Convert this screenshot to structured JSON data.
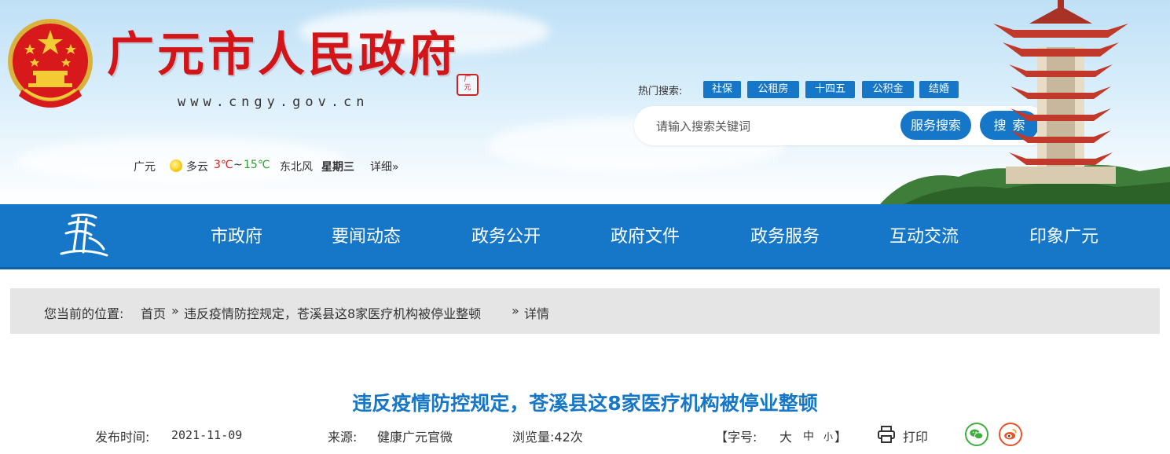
{
  "header": {
    "site_title": "广元市人民政府",
    "site_url": "www.cngy.gov.cn",
    "seal_text": "广元市"
  },
  "hot_search": {
    "label": "热门搜索:",
    "tags": [
      "社保",
      "公租房",
      "十四五",
      "公积金",
      "结婚"
    ]
  },
  "search": {
    "placeholder": "请输入搜索关键词",
    "service_button": "服务搜索",
    "search_button": "搜索"
  },
  "weather": {
    "city": "广元",
    "condition": "多云",
    "low": "3℃",
    "sep": "~",
    "high": "15℃",
    "wind": "东北风",
    "weekday": "星期三",
    "detail_link": "详细»"
  },
  "nav": {
    "items": [
      "市政府",
      "要闻动态",
      "政务公开",
      "政府文件",
      "政务服务",
      "互动交流",
      "印象广元"
    ]
  },
  "breadcrumb": {
    "prefix": "您当前的位置:",
    "home": "首页",
    "sep": "»",
    "article": "违反疫情防控规定，苍溪县这8家医疗机构被停业整顿",
    "current": "详情"
  },
  "article": {
    "title": "违反疫情防控规定，苍溪县这8家医疗机构被停业整顿",
    "publish_label": "发布时间:",
    "publish_date": "2021-11-09",
    "source_label": "来源:",
    "source": "健康广元官微",
    "views": "浏览量:42次",
    "font_label_open": "【字号:",
    "font_large": "大",
    "font_medium": "中",
    "font_small": "小",
    "font_label_close": "】",
    "print": "打印"
  },
  "colors": {
    "brand_blue": "#1677c8",
    "title_red": "#d21518",
    "temp_low": "#e02020",
    "temp_high": "#2e9e2e"
  }
}
